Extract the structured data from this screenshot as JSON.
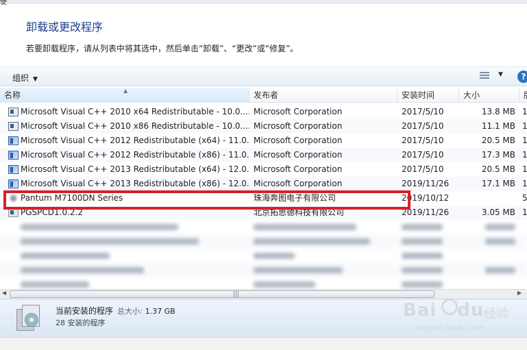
{
  "top_fragment": "使",
  "heading": "卸载或更改程序",
  "subtext": "若要卸载程序，请从列表中将其选中，然后单击“卸载”、“更改”或“修复”。",
  "toolbar": {
    "organize_label": "组织",
    "help_label": "?"
  },
  "columns": {
    "name": "名称",
    "publisher": "发布者",
    "installed_on": "安装时间",
    "size": "大小",
    "extra": "版"
  },
  "rows": [
    {
      "name": "Microsoft Visual C++ 2010  x64 Redistributable - 10.0....",
      "publisher": "Microsoft Corporation",
      "date": "2017/5/10",
      "size": "13.8 MB",
      "extra": "1",
      "icon": "installer-icon"
    },
    {
      "name": "Microsoft Visual C++ 2010  x86 Redistributable - 10.0....",
      "publisher": "Microsoft Corporation",
      "date": "2017/5/10",
      "size": "11.1 MB",
      "extra": "1",
      "icon": "installer-icon"
    },
    {
      "name": "Microsoft Visual C++ 2012 Redistributable (x64) - 11.0....",
      "publisher": "Microsoft Corporation",
      "date": "2017/5/10",
      "size": "20.5 MB",
      "extra": "1",
      "icon": "package-icon"
    },
    {
      "name": "Microsoft Visual C++ 2012 Redistributable (x86) - 11.0....",
      "publisher": "Microsoft Corporation",
      "date": "2017/5/10",
      "size": "17.3 MB",
      "extra": "1",
      "icon": "package-icon"
    },
    {
      "name": "Microsoft Visual C++ 2013 Redistributable (x64) - 12.0....",
      "publisher": "Microsoft Corporation",
      "date": "2017/5/10",
      "size": "20.5 MB",
      "extra": "1",
      "icon": "package-icon"
    },
    {
      "name": "Microsoft Visual C++ 2013 Redistributable (x86) - 12.0....",
      "publisher": "Microsoft Corporation",
      "date": "2019/11/26",
      "size": "17.1 MB",
      "extra": "1",
      "icon": "package-icon"
    },
    {
      "name": "Pantum M7100DN Series",
      "publisher": "珠海奔图电子有限公司",
      "date": "2019/10/12",
      "size": "",
      "extra": "5",
      "icon": "gear-icon"
    },
    {
      "name": "PGSPCD1.0.2.2",
      "publisher": "北京拓思德科技有限公司",
      "date": "2019/11/26",
      "size": "3.05 MB",
      "extra": "1",
      "icon": "box-icon"
    }
  ],
  "details": {
    "title": "当前安装的程序",
    "total_label": "总大小:",
    "total_value": "1.37 GB",
    "count": "28 安装的程序"
  },
  "watermark": {
    "brand_a": "Bai",
    "brand_b": "du",
    "brand_c": "经验",
    "url": "jingyan.baidu.com"
  },
  "colors": {
    "heading": "#1e3f8a",
    "highlight": "#d6202a",
    "details_bg": "#dbe7f4"
  }
}
